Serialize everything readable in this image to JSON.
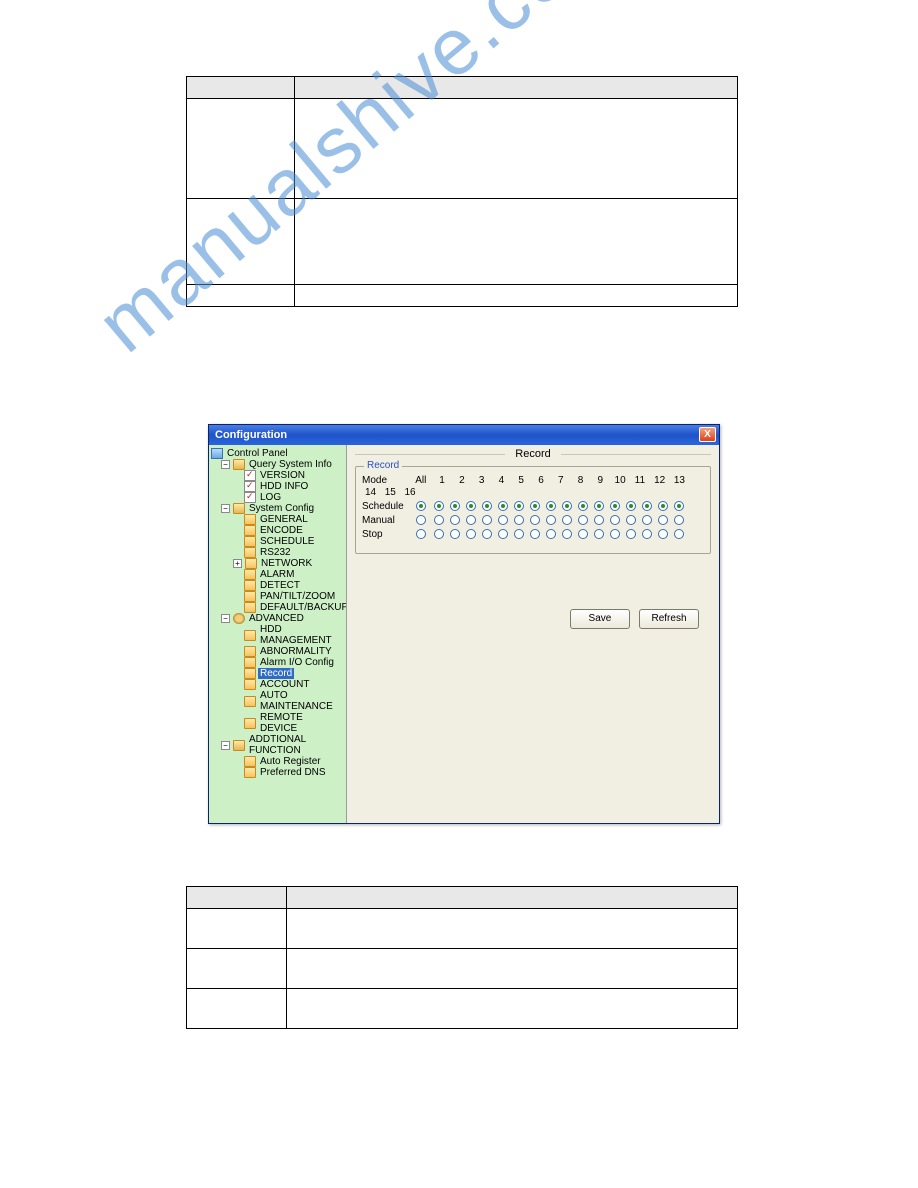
{
  "watermark": "manualshive.com",
  "dialog": {
    "title": "Configuration",
    "close_symbol": "X",
    "panel_title": "Record",
    "fieldset_legend": "Record",
    "save_label": "Save",
    "refresh_label": "Refresh"
  },
  "tree": {
    "root": "Control Panel",
    "groups": [
      {
        "label": "Query System Info",
        "expanded": true,
        "children": [
          {
            "label": "VERSION",
            "icon": "doc"
          },
          {
            "label": "HDD INFO",
            "icon": "doc"
          },
          {
            "label": "LOG",
            "icon": "doc"
          }
        ]
      },
      {
        "label": "System Config",
        "expanded": true,
        "children": [
          {
            "label": "GENERAL",
            "icon": "folder"
          },
          {
            "label": "ENCODE",
            "icon": "folder"
          },
          {
            "label": "SCHEDULE",
            "icon": "folder"
          },
          {
            "label": "RS232",
            "icon": "folder"
          },
          {
            "label": "NETWORK",
            "icon": "folder",
            "expandable": true
          },
          {
            "label": "ALARM",
            "icon": "folder"
          },
          {
            "label": "DETECT",
            "icon": "folder"
          },
          {
            "label": "PAN/TILT/ZOOM",
            "icon": "folder"
          },
          {
            "label": "DEFAULT/BACKUP",
            "icon": "folder"
          }
        ]
      },
      {
        "label": "ADVANCED",
        "icon": "gear",
        "expanded": true,
        "children": [
          {
            "label": "HDD MANAGEMENT",
            "icon": "folder"
          },
          {
            "label": "ABNORMALITY",
            "icon": "folder"
          },
          {
            "label": "Alarm I/O Config",
            "icon": "folder"
          },
          {
            "label": "Record",
            "icon": "folder",
            "selected": true
          },
          {
            "label": "ACCOUNT",
            "icon": "folder"
          },
          {
            "label": "AUTO MAINTENANCE",
            "icon": "folder"
          },
          {
            "label": "REMOTE DEVICE",
            "icon": "folder"
          }
        ]
      },
      {
        "label": "ADDTIONAL FUNCTION",
        "expanded": true,
        "children": [
          {
            "label": "Auto Register",
            "icon": "folder"
          },
          {
            "label": "Preferred DNS",
            "icon": "folder"
          }
        ]
      }
    ]
  },
  "record": {
    "mode_label": "Mode",
    "all_label": "All",
    "columns": [
      "1",
      "2",
      "3",
      "4",
      "5",
      "6",
      "7",
      "8",
      "9",
      "10",
      "11",
      "12",
      "13",
      "14",
      "15",
      "16"
    ],
    "rows": [
      {
        "label": "Schedule",
        "all": true,
        "cells": [
          true,
          true,
          true,
          true,
          true,
          true,
          true,
          true,
          true,
          true,
          true,
          true,
          true,
          true,
          true,
          true
        ]
      },
      {
        "label": "Manual",
        "all": false,
        "cells": [
          false,
          false,
          false,
          false,
          false,
          false,
          false,
          false,
          false,
          false,
          false,
          false,
          false,
          false,
          false,
          false
        ]
      },
      {
        "label": "Stop",
        "all": false,
        "cells": [
          false,
          false,
          false,
          false,
          false,
          false,
          false,
          false,
          false,
          false,
          false,
          false,
          false,
          false,
          false,
          false
        ]
      }
    ]
  }
}
